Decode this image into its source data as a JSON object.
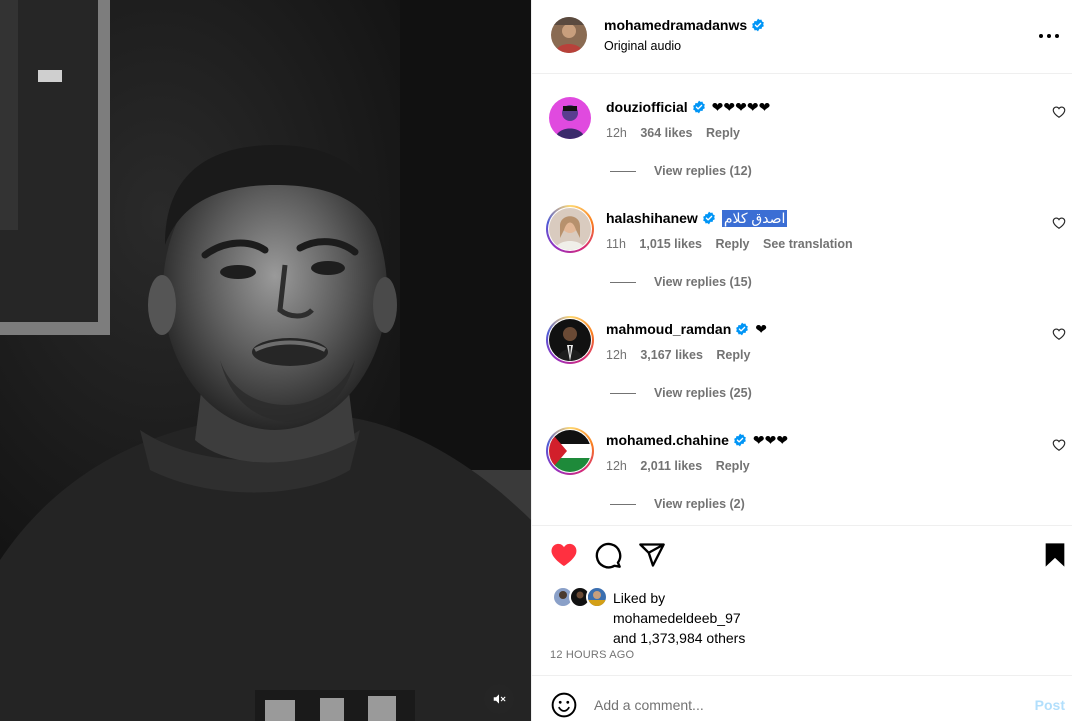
{
  "post": {
    "author": "mohamedramadanws",
    "subtitle": "Original audio",
    "more_icon": "more-horizontal-icon"
  },
  "comments": [
    {
      "username": "douziofficial",
      "text": "❤❤❤❤❤",
      "time": "12h",
      "likes": "364 likes",
      "reply": "Reply",
      "translate": "",
      "replies": "View replies (12)",
      "selected": false
    },
    {
      "username": "halashihanew",
      "text": "اصدق كلام",
      "time": "11h",
      "likes": "1,015 likes",
      "reply": "Reply",
      "translate": "See translation",
      "replies": "View replies (15)",
      "selected": true
    },
    {
      "username": "mahmoud_ramdan",
      "text": "❤",
      "time": "12h",
      "likes": "3,167 likes",
      "reply": "Reply",
      "translate": "",
      "replies": "View replies (25)",
      "selected": false
    },
    {
      "username": "mohamed.chahine",
      "text": "❤❤❤",
      "time": "12h",
      "likes": "2,011 likes",
      "reply": "Reply",
      "translate": "",
      "replies": "View replies (2)",
      "selected": false
    }
  ],
  "actions": {
    "like_icon": "heart-filled-icon",
    "comment_icon": "comment-icon",
    "share_icon": "share-icon",
    "save_icon": "bookmark-filled-icon",
    "like_color": "#ff3040"
  },
  "liked_by": {
    "prefix": "Liked by",
    "user": "mohamedeldeeb_97",
    "others": "and 1,373,984 others"
  },
  "timestamp": "12 HOURS AGO",
  "add_comment": {
    "placeholder": "Add a comment...",
    "post_label": "Post"
  },
  "colors": {
    "verified": "#0095f6",
    "muted": "#737373",
    "post_disabled": "#b2dffc",
    "selection": "#3b6ed4"
  }
}
